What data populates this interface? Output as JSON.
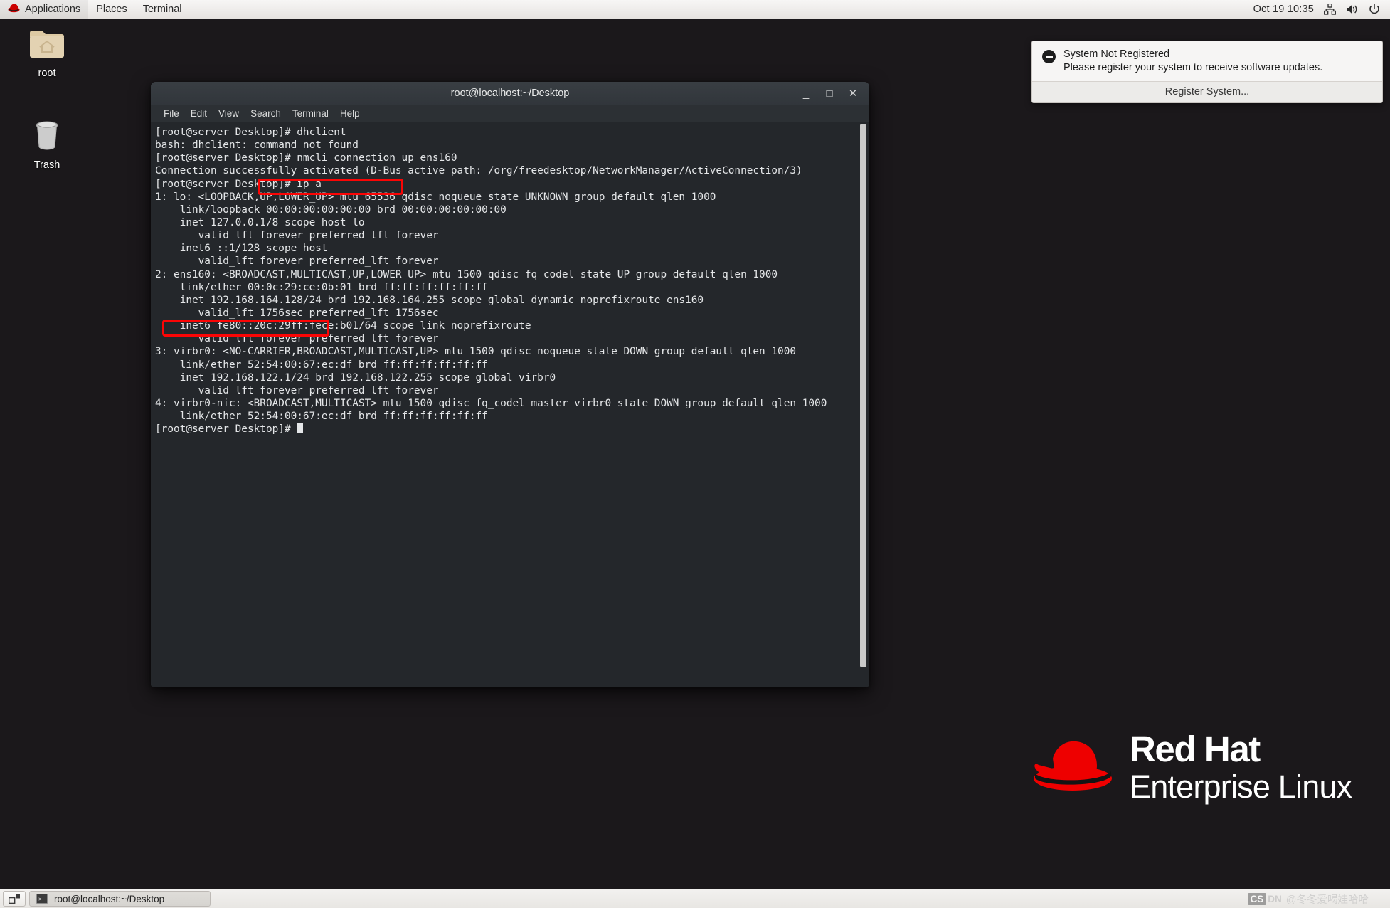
{
  "top_panel": {
    "items": [
      {
        "label": "Applications",
        "icon": "redhat-icon"
      },
      {
        "label": "Places",
        "icon": null
      },
      {
        "label": "Terminal",
        "icon": null
      }
    ],
    "clock": "Oct 19  10:35",
    "tray": [
      {
        "icon": "network-icon",
        "name": "network-status-icon"
      },
      {
        "icon": "volume-icon",
        "name": "volume-icon"
      },
      {
        "icon": "power-icon",
        "name": "power-icon"
      }
    ]
  },
  "desktop": {
    "icons": [
      {
        "label": "root",
        "icon": "home-folder-icon"
      },
      {
        "label": "Trash",
        "icon": "trash-icon"
      }
    ],
    "background_color": "#1b181b"
  },
  "terminal": {
    "title": "root@localhost:~/Desktop",
    "window_buttons": {
      "minimize": "_",
      "maximize": "□",
      "close": "✕"
    },
    "menu": [
      "File",
      "Edit",
      "View",
      "Search",
      "Terminal",
      "Help"
    ],
    "background_color": "#24272b",
    "text_color": "#e4e6e8",
    "lines": [
      "[root@server Desktop]# dhclient",
      "bash: dhclient: command not found",
      "[root@server Desktop]# nmcli connection up ens160",
      "Connection successfully activated (D-Bus active path: /org/freedesktop/NetworkManager/ActiveConnection/3)",
      "[root@server Desktop]# ip a",
      "1: lo: <LOOPBACK,UP,LOWER_UP> mtu 65536 qdisc noqueue state UNKNOWN group default qlen 1000",
      "    link/loopback 00:00:00:00:00:00 brd 00:00:00:00:00:00",
      "    inet 127.0.0.1/8 scope host lo",
      "       valid_lft forever preferred_lft forever",
      "    inet6 ::1/128 scope host",
      "       valid_lft forever preferred_lft forever",
      "2: ens160: <BROADCAST,MULTICAST,UP,LOWER_UP> mtu 1500 qdisc fq_codel state UP group default qlen 1000",
      "    link/ether 00:0c:29:ce:0b:01 brd ff:ff:ff:ff:ff:ff",
      "    inet 192.168.164.128/24 brd 192.168.164.255 scope global dynamic noprefixroute ens160",
      "       valid_lft 1756sec preferred_lft 1756sec",
      "    inet6 fe80::20c:29ff:fece:b01/64 scope link noprefixroute",
      "       valid_lft forever preferred_lft forever",
      "3: virbr0: <NO-CARRIER,BROADCAST,MULTICAST,UP> mtu 1500 qdisc noqueue state DOWN group default qlen 1000",
      "    link/ether 52:54:00:67:ec:df brd ff:ff:ff:ff:ff:ff",
      "    inet 192.168.122.1/24 brd 192.168.122.255 scope global virbr0",
      "       valid_lft forever preferred_lft forever",
      "4: virbr0-nic: <BROADCAST,MULTICAST> mtu 1500 qdisc fq_codel master virbr0 state DOWN group default qlen 1000",
      "    link/ether 52:54:00:67:ec:df brd ff:ff:ff:ff:ff:ff",
      "[root@server Desktop]# "
    ],
    "annotations": [
      {
        "name": "nmcli-command-highlight",
        "text": "nmcli connection up ens160",
        "color": "#fb0505"
      },
      {
        "name": "inet-address-highlight",
        "text": "inet 192.168.164.128/24",
        "color": "#fb0505"
      }
    ]
  },
  "notification": {
    "title": "System Not Registered",
    "message": "Please register your system to receive software updates.",
    "action_label": "Register System...",
    "icon": "minus-circle-icon"
  },
  "branding": {
    "line1": "Red Hat",
    "line2": "Enterprise Linux",
    "logo_color": "#ee0000"
  },
  "taskbar": {
    "workspace_switcher_icon": "workspace-switcher-icon",
    "window_button_label": "root@localhost:~/Desktop",
    "window_button_icon": "terminal-icon"
  },
  "watermark": {
    "brand_mark": "CSDN",
    "brand_mark_prefix": "CS",
    "brand_mark_suffix": "DN",
    "handle": "@冬冬爱喝娃哈哈"
  }
}
